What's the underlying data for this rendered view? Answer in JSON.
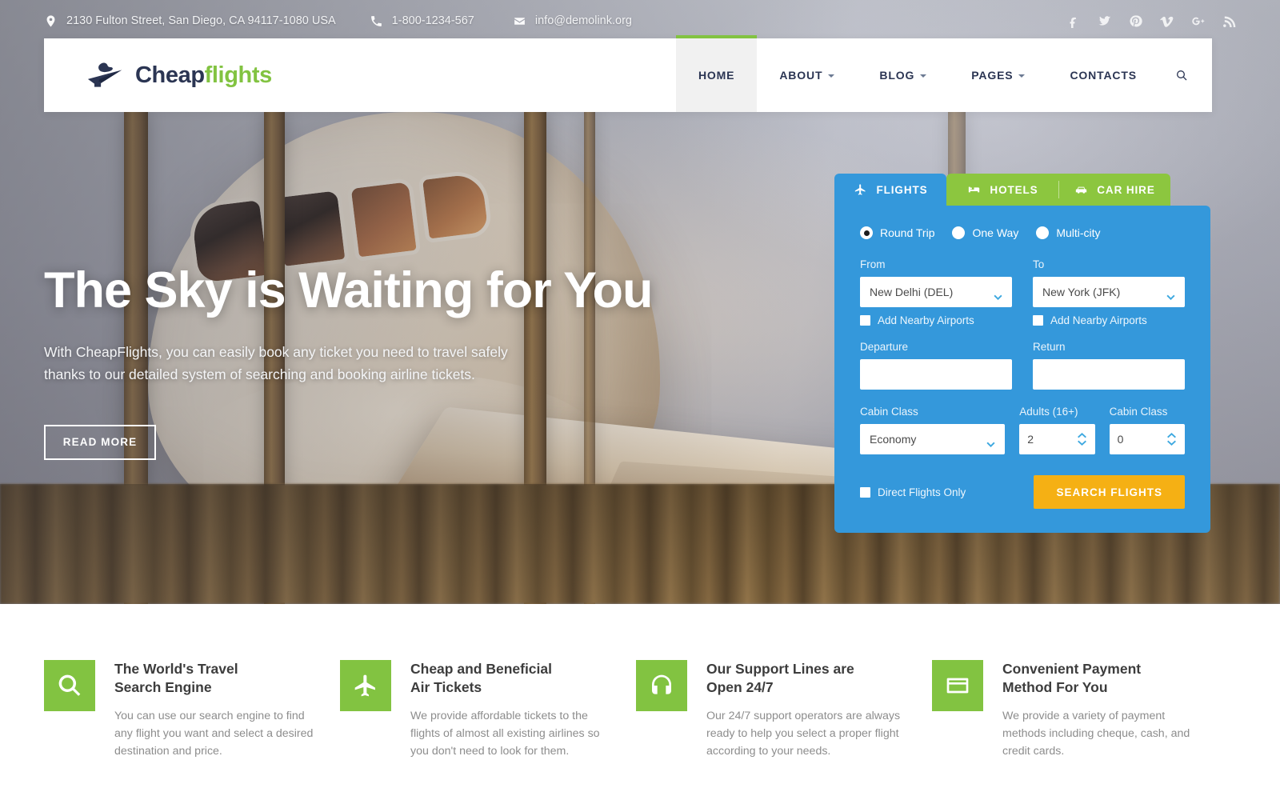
{
  "topbar": {
    "address": "2130 Fulton Street, San Diego, CA 94117-1080 USA",
    "phone": "1-800-1234-567",
    "email": "info@demolink.org",
    "socials": [
      {
        "name": "facebook-icon"
      },
      {
        "name": "twitter-icon"
      },
      {
        "name": "pinterest-icon"
      },
      {
        "name": "vimeo-icon"
      },
      {
        "name": "google-plus-icon"
      },
      {
        "name": "rss-icon"
      }
    ]
  },
  "header": {
    "logo_primary": "Cheap",
    "logo_accent": "flights",
    "nav": [
      {
        "label": "HOME",
        "active": true,
        "dropdown": false
      },
      {
        "label": "ABOUT",
        "active": false,
        "dropdown": true
      },
      {
        "label": "BLOG",
        "active": false,
        "dropdown": true
      },
      {
        "label": "PAGES",
        "active": false,
        "dropdown": true
      },
      {
        "label": "CONTACTS",
        "active": false,
        "dropdown": false
      }
    ],
    "search_icon": "search-icon"
  },
  "hero": {
    "title": "The Sky is Waiting for You",
    "subtitle": "With CheapFlights, you can easily book any ticket you need to travel safely thanks to our detailed system of searching and booking airline tickets.",
    "cta": "READ MORE"
  },
  "widget": {
    "tabs": [
      {
        "label": "FLIGHTS",
        "icon": "airplane-icon",
        "active": true
      },
      {
        "label": "HOTELS",
        "icon": "bed-icon",
        "active": false
      },
      {
        "label": "CAR HIRE",
        "icon": "car-icon",
        "active": false
      }
    ],
    "trip_types": [
      {
        "label": "Round Trip",
        "selected": true
      },
      {
        "label": "One Way",
        "selected": false
      },
      {
        "label": "Multi-city",
        "selected": false
      }
    ],
    "from_label": "From",
    "from_value": "New Delhi (DEL)",
    "to_label": "To",
    "to_value": "New York (JFK)",
    "nearby_from_label": "Add Nearby Airports",
    "nearby_to_label": "Add Nearby Airports",
    "departure_label": "Departure",
    "departure_value": "",
    "return_label": "Return",
    "return_value": "",
    "cabin_label": "Cabin Class",
    "cabin_value": "Economy",
    "adults_label": "Adults (16+)",
    "adults_value": "2",
    "children_label": "Cabin Class",
    "children_value": "0",
    "direct_label": "Direct Flights Only",
    "search_button": "SEARCH FLIGHTS",
    "accent_blue": "#3498db",
    "accent_green": "#8cc63f",
    "accent_yellow": "#f5b014"
  },
  "features": [
    {
      "icon": "search-icon",
      "title_line1": "The World's Travel",
      "title_line2": "Search Engine",
      "text": "You can use our search engine to find any flight you want and select a desired destination and price."
    },
    {
      "icon": "airplane-icon",
      "title_line1": "Cheap and Beneficial",
      "title_line2": "Air Tickets",
      "text": "We provide affordable tickets to the flights of almost all existing airlines so you don't need to look for them."
    },
    {
      "icon": "headset-icon",
      "title_line1": "Our Support Lines are",
      "title_line2": "Open 24/7",
      "text": "Our 24/7 support operators are always ready to help you select a proper flight according to your needs."
    },
    {
      "icon": "credit-card-icon",
      "title_line1": "Convenient Payment",
      "title_line2": "Method For You",
      "text": "We provide a variety of payment methods including cheque, cash, and credit cards."
    }
  ]
}
